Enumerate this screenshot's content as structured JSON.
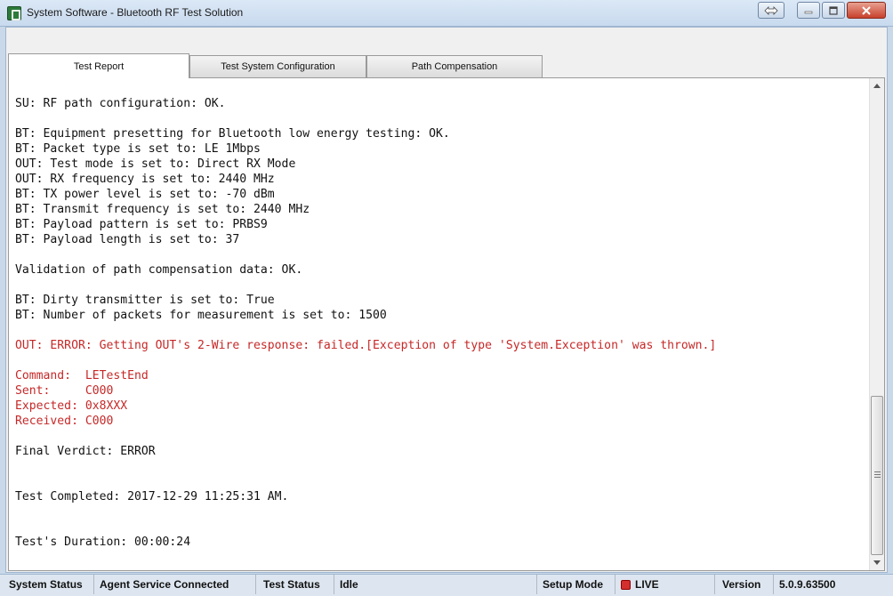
{
  "window": {
    "title": "System Software - Bluetooth RF Test Solution"
  },
  "tabs": [
    {
      "label": "Test Report"
    },
    {
      "label": "Test System Configuration"
    },
    {
      "label": "Path Compensation"
    }
  ],
  "log_lines": [
    {
      "text": "SU: RF path configuration: OK.",
      "status": "normal"
    },
    {
      "text": "",
      "status": "normal"
    },
    {
      "text": "BT: Equipment presetting for Bluetooth low energy testing: OK.",
      "status": "normal"
    },
    {
      "text": "BT: Packet type is set to: LE 1Mbps",
      "status": "normal"
    },
    {
      "text": "OUT: Test mode is set to: Direct RX Mode",
      "status": "normal"
    },
    {
      "text": "OUT: RX frequency is set to: 2440 MHz",
      "status": "normal"
    },
    {
      "text": "BT: TX power level is set to: -70 dBm",
      "status": "normal"
    },
    {
      "text": "BT: Transmit frequency is set to: 2440 MHz",
      "status": "normal"
    },
    {
      "text": "BT: Payload pattern is set to: PRBS9",
      "status": "normal"
    },
    {
      "text": "BT: Payload length is set to: 37",
      "status": "normal"
    },
    {
      "text": "",
      "status": "normal"
    },
    {
      "text": "Validation of path compensation data: OK.",
      "status": "normal"
    },
    {
      "text": "",
      "status": "normal"
    },
    {
      "text": "BT: Dirty transmitter is set to: True",
      "status": "normal"
    },
    {
      "text": "BT: Number of packets for measurement is set to: 1500",
      "status": "normal"
    },
    {
      "text": "",
      "status": "normal"
    },
    {
      "text": "OUT: ERROR: Getting OUT's 2-Wire response: failed.[Exception of type 'System.Exception' was thrown.]",
      "status": "error"
    },
    {
      "text": "",
      "status": "normal"
    },
    {
      "text": "Command:  LETestEnd",
      "status": "error"
    },
    {
      "text": "Sent:     C000",
      "status": "error"
    },
    {
      "text": "Expected: 0x8XXX",
      "status": "error"
    },
    {
      "text": "Received: C000",
      "status": "error"
    },
    {
      "text": "",
      "status": "normal"
    },
    {
      "text": "Final Verdict: ERROR",
      "status": "normal"
    },
    {
      "text": "",
      "status": "normal"
    },
    {
      "text": "",
      "status": "normal"
    },
    {
      "text": "Test Completed: 2017-12-29 11:25:31 AM.",
      "status": "normal"
    },
    {
      "text": "",
      "status": "normal"
    },
    {
      "text": "",
      "status": "normal"
    },
    {
      "text": "Test's Duration: 00:00:24",
      "status": "normal"
    }
  ],
  "status_bar": {
    "system_status_label": "System Status",
    "system_status_value": "Agent Service Connected",
    "test_status_label": "Test Status",
    "test_status_value": "Idle",
    "setup_mode_label": "Setup Mode",
    "setup_mode_value": "LIVE",
    "version_label": "Version",
    "version_value": "5.0.9.63500"
  },
  "colors": {
    "error_text": "#c62828",
    "live_indicator": "#d32f2f"
  }
}
